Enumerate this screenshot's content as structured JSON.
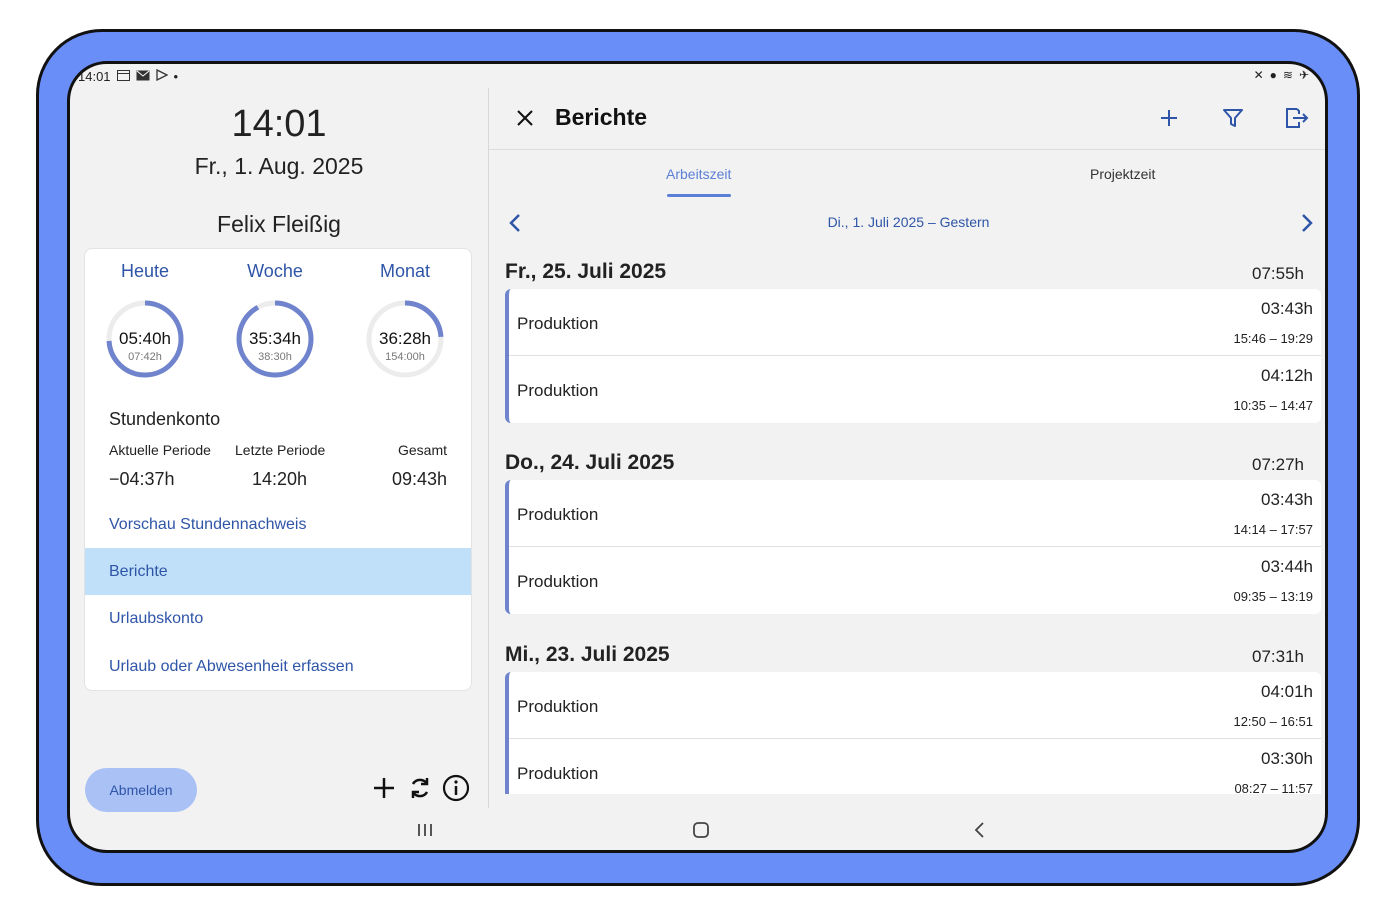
{
  "status": {
    "time": "14:01"
  },
  "left": {
    "clock": "14:01",
    "date": "Fr., 1. Aug. 2025",
    "user": "Felix Fleißig",
    "gauges": [
      {
        "label": "Heute",
        "value": "05:40h",
        "target": "07:42h",
        "fraction": 0.74
      },
      {
        "label": "Woche",
        "value": "35:34h",
        "target": "38:30h",
        "fraction": 0.92
      },
      {
        "label": "Monat",
        "value": "36:28h",
        "target": "154:00h",
        "fraction": 0.24
      }
    ],
    "account": {
      "title": "Stundenkonto",
      "cols": [
        {
          "label": "Aktuelle Periode",
          "value": "−04:37h"
        },
        {
          "label": "Letzte Periode",
          "value": "14:20h"
        },
        {
          "label": "Gesamt",
          "value": "09:43h"
        }
      ]
    },
    "links": {
      "preview": "Vorschau Stundennachweis",
      "reports": "Berichte",
      "vacation": "Urlaubskonto",
      "absence": "Urlaub oder Abwesenheit erfassen"
    },
    "logout": "Abmelden"
  },
  "right": {
    "title": "Berichte",
    "tabs": [
      "Arbeitszeit",
      "Projektzeit"
    ],
    "range": "Di., 1. Juli 2025 – Gestern",
    "days": [
      {
        "date": "Fr., 25. Juli 2025",
        "total": "07:55h",
        "entries": [
          {
            "name": "Produktion",
            "dur": "03:43h",
            "span": "15:46 – 19:29"
          },
          {
            "name": "Produktion",
            "dur": "04:12h",
            "span": "10:35 – 14:47"
          }
        ]
      },
      {
        "date": "Do., 24. Juli 2025",
        "total": "07:27h",
        "entries": [
          {
            "name": "Produktion",
            "dur": "03:43h",
            "span": "14:14 – 17:57"
          },
          {
            "name": "Produktion",
            "dur": "03:44h",
            "span": "09:35 – 13:19"
          }
        ]
      },
      {
        "date": "Mi., 23. Juli 2025",
        "total": "07:31h",
        "entries": [
          {
            "name": "Produktion",
            "dur": "04:01h",
            "span": "12:50 – 16:51"
          },
          {
            "name": "Produktion",
            "dur": "03:30h",
            "span": "08:27 – 11:57"
          }
        ]
      }
    ]
  },
  "colors": {
    "frame": "#6a8ef7",
    "accent": "#2f55a8",
    "tab_active": "#5b7fd6",
    "selected_bg": "#bfe0f8",
    "entry_bar": "#6f84cc"
  }
}
